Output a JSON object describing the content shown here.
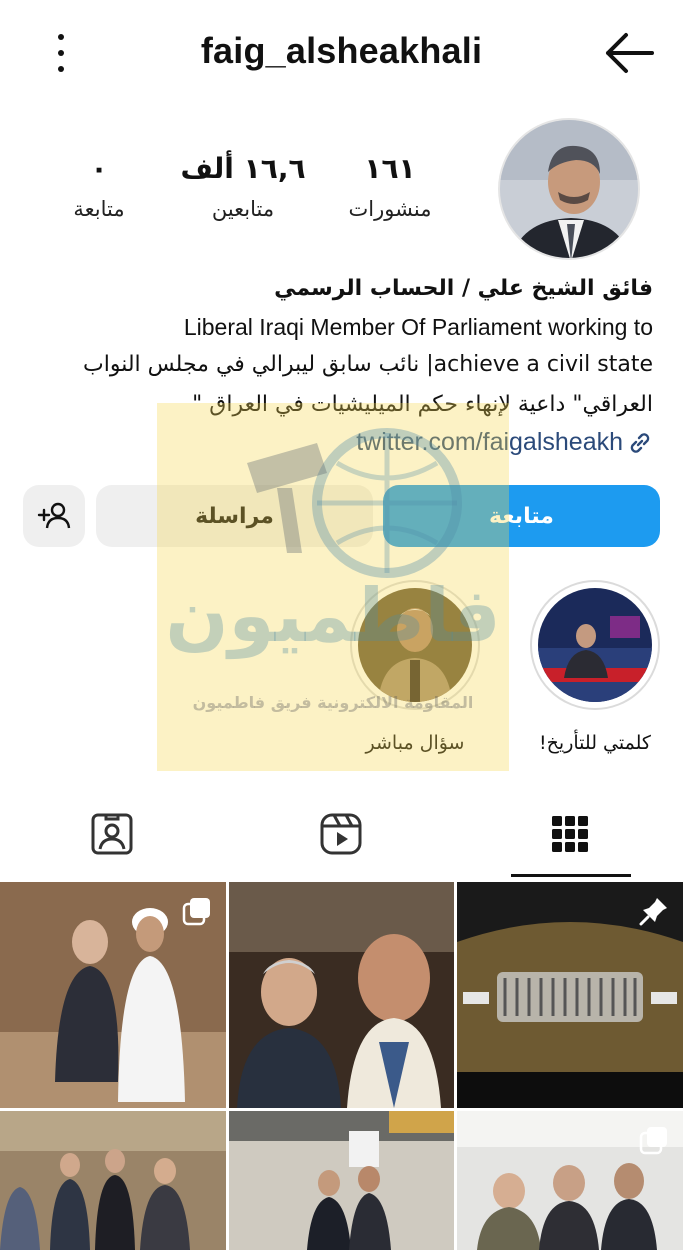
{
  "header": {
    "username": "faig_alsheakhali",
    "menu_icon": "more-vertical-icon",
    "back_icon": "arrow-left-icon"
  },
  "stats": {
    "posts": {
      "value": "١٦١",
      "label": "منشورات"
    },
    "followers": {
      "value": "١٦,٦ ألف",
      "label": "متابعين"
    },
    "following": {
      "value": "٠",
      "label": "متابعة"
    }
  },
  "bio": {
    "name": "فائق الشيخ علي / الحساب الرسمي",
    "line1": "Liberal Iraqi Member Of Parliament working to",
    "line2": "achieve a civil state| نائب سابق ليبرالي في مجلس النواب",
    "line3": "العراقي\" داعية لإنهاء حكم الميليشيات في العراق \"",
    "link": "twitter.com/faigalsheakh"
  },
  "actions": {
    "follow": "متابعة",
    "message": "مراسلة",
    "add_user_icon": "add-user-icon"
  },
  "highlights": [
    {
      "caption": "كلمتي للتأريخ!"
    },
    {
      "caption": "سؤال مباشر"
    }
  ],
  "watermark": {
    "main": "فاطميون",
    "sub": "المقاومة الالكترونية فريق فاطميون"
  },
  "tabs": [
    {
      "icon": "grid-icon",
      "active": true
    },
    {
      "icon": "reels-icon",
      "active": false
    },
    {
      "icon": "tagged-icon",
      "active": false
    }
  ],
  "colors": {
    "accent": "#1d9bf0",
    "button_gray": "#efefef",
    "link": "#2b4a7a"
  }
}
